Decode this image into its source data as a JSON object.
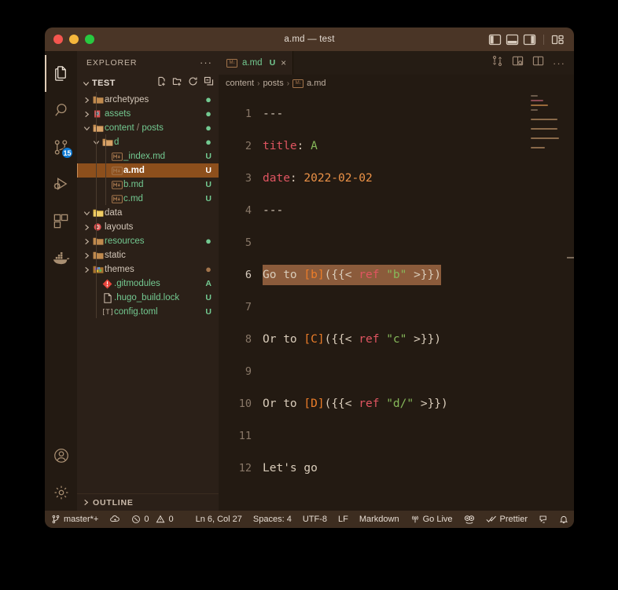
{
  "window": {
    "title": "a.md — test",
    "traffic_lights": [
      "close-red",
      "minimize-yellow",
      "maximize-green"
    ],
    "layout_controls": [
      "toggle-primary-sidebar",
      "toggle-panel",
      "toggle-secondary-sidebar",
      "customize-layout"
    ]
  },
  "activity_bar": {
    "items": [
      {
        "name": "explorer",
        "icon": "files-icon",
        "active": true,
        "badge": ""
      },
      {
        "name": "search",
        "icon": "search-icon",
        "active": false,
        "badge": ""
      },
      {
        "name": "source-control",
        "icon": "source-control-icon",
        "active": false,
        "badge": "15"
      },
      {
        "name": "run-and-debug",
        "icon": "run-debug-icon",
        "active": false,
        "badge": ""
      },
      {
        "name": "extensions",
        "icon": "extensions-icon",
        "active": false,
        "badge": ""
      },
      {
        "name": "docker",
        "icon": "docker-whale-icon",
        "active": false,
        "badge": ""
      }
    ],
    "bottom_items": [
      {
        "name": "accounts",
        "icon": "account-icon"
      },
      {
        "name": "manage-settings",
        "icon": "gear-icon"
      }
    ]
  },
  "sidebar": {
    "title": "EXPLORER",
    "more_actions": "···",
    "root": {
      "label": "TEST",
      "expanded": true,
      "actions": [
        "new-file-icon",
        "new-folder-icon",
        "refresh-icon",
        "collapse-all-icon"
      ]
    },
    "tree": [
      {
        "label": "archetypes",
        "indent": 1,
        "type": "folder",
        "icon": "folder-icon",
        "expanded": false,
        "status": "●",
        "status_kind": "g",
        "color": "default",
        "selected": false
      },
      {
        "label": "assets",
        "indent": 1,
        "type": "folder",
        "icon": "folder-assets-icon",
        "expanded": false,
        "status": "●",
        "status_kind": "g",
        "color": "green",
        "selected": false
      },
      {
        "label": "content / posts",
        "indent": 1,
        "type": "folder",
        "icon": "folder-open-icon",
        "expanded": true,
        "status": "●",
        "status_kind": "g",
        "color": "green",
        "selected": false
      },
      {
        "label": "d",
        "indent": 2,
        "type": "folder",
        "icon": "folder-open-icon",
        "expanded": true,
        "status": "●",
        "status_kind": "g",
        "color": "green",
        "selected": false
      },
      {
        "label": "_index.md",
        "indent": 3,
        "type": "file",
        "icon": "markdown-icon",
        "status": "U",
        "status_kind": "g",
        "color": "green",
        "selected": false
      },
      {
        "label": "a.md",
        "indent": 3,
        "type": "file",
        "icon": "markdown-icon",
        "status": "U",
        "status_kind": "sel",
        "color": "sel",
        "selected": true
      },
      {
        "label": "b.md",
        "indent": 3,
        "type": "file",
        "icon": "markdown-icon",
        "status": "U",
        "status_kind": "g",
        "color": "green",
        "selected": false
      },
      {
        "label": "c.md",
        "indent": 3,
        "type": "file",
        "icon": "markdown-icon",
        "status": "U",
        "status_kind": "g",
        "color": "green",
        "selected": false
      },
      {
        "label": "data",
        "indent": 1,
        "type": "folder",
        "icon": "folder-data-icon",
        "expanded": true,
        "status": "",
        "status_kind": "g",
        "color": "default",
        "selected": false
      },
      {
        "label": "layouts",
        "indent": 1,
        "type": "folder",
        "icon": "folder-layouts-icon",
        "expanded": false,
        "status": "",
        "status_kind": "g",
        "color": "default",
        "selected": false
      },
      {
        "label": "resources",
        "indent": 1,
        "type": "folder",
        "icon": "folder-icon",
        "expanded": false,
        "status": "●",
        "status_kind": "g",
        "color": "green",
        "selected": false
      },
      {
        "label": "static",
        "indent": 1,
        "type": "folder",
        "icon": "folder-icon",
        "expanded": false,
        "status": "",
        "status_kind": "g",
        "color": "default",
        "selected": false
      },
      {
        "label": "themes",
        "indent": 1,
        "type": "folder",
        "icon": "folder-themes-icon",
        "expanded": false,
        "status": "●",
        "status_kind": "brown",
        "color": "default",
        "selected": false
      },
      {
        "label": ".gitmodules",
        "indent": 2,
        "type": "file",
        "icon": "git-icon",
        "status": "A",
        "status_kind": "g",
        "color": "green",
        "selected": false
      },
      {
        "label": ".hugo_build.lock",
        "indent": 2,
        "type": "file",
        "icon": "file-icon",
        "status": "U",
        "status_kind": "g",
        "color": "green",
        "selected": false
      },
      {
        "label": "config.toml",
        "indent": 2,
        "type": "file",
        "icon": "toml-icon",
        "status": "U",
        "status_kind": "g",
        "color": "green",
        "selected": false
      }
    ],
    "outline": {
      "label": "OUTLINE",
      "expanded": false
    }
  },
  "editor": {
    "tab": {
      "icon": "markdown-icon",
      "label": "a.md",
      "git_badge": "U",
      "close": "×"
    },
    "actions": [
      "run-markdown-icon",
      "open-preview-to-side-icon",
      "split-editor-icon",
      "more-actions-icon"
    ],
    "breadcrumbs": [
      "content",
      "posts",
      "a.md"
    ],
    "breadcrumb_separator": "›",
    "lines": [
      {
        "n": "1",
        "current": false,
        "highlight": false,
        "tokens": [
          {
            "t": "---",
            "c": "t-hr"
          }
        ]
      },
      {
        "n": "2",
        "current": false,
        "highlight": false,
        "tokens": [
          {
            "t": "title",
            "c": "t-key"
          },
          {
            "t": ": ",
            "c": "t-colon"
          },
          {
            "t": "A",
            "c": "t-val-green"
          }
        ]
      },
      {
        "n": "3",
        "current": false,
        "highlight": false,
        "tokens": [
          {
            "t": "date",
            "c": "t-key"
          },
          {
            "t": ": ",
            "c": "t-colon"
          },
          {
            "t": "2022-02-02",
            "c": "t-num"
          }
        ]
      },
      {
        "n": "4",
        "current": false,
        "highlight": false,
        "tokens": [
          {
            "t": "---",
            "c": "t-hr"
          }
        ]
      },
      {
        "n": "5",
        "current": false,
        "highlight": false,
        "tokens": []
      },
      {
        "n": "6",
        "current": true,
        "highlight": true,
        "tokens": [
          {
            "t": "Go to ",
            "c": "t-plain"
          },
          {
            "t": "[",
            "c": "t-bracket"
          },
          {
            "t": "b",
            "c": "t-bracket"
          },
          {
            "t": "]",
            "c": "t-bracket"
          },
          {
            "t": "({{< ",
            "c": "t-brace"
          },
          {
            "t": "ref",
            "c": "t-ref"
          },
          {
            "t": " ",
            "c": "t-brace"
          },
          {
            "t": "\"b\"",
            "c": "t-str"
          },
          {
            "t": " >}})",
            "c": "t-brace"
          }
        ]
      },
      {
        "n": "7",
        "current": false,
        "highlight": false,
        "tokens": []
      },
      {
        "n": "8",
        "current": false,
        "highlight": false,
        "tokens": [
          {
            "t": "Or to ",
            "c": "t-plain"
          },
          {
            "t": "[",
            "c": "t-bracket"
          },
          {
            "t": "C",
            "c": "t-bracket"
          },
          {
            "t": "]",
            "c": "t-bracket"
          },
          {
            "t": "({{< ",
            "c": "t-brace"
          },
          {
            "t": "ref",
            "c": "t-ref"
          },
          {
            "t": " ",
            "c": "t-brace"
          },
          {
            "t": "\"c\"",
            "c": "t-str"
          },
          {
            "t": " >}})",
            "c": "t-brace"
          }
        ]
      },
      {
        "n": "9",
        "current": false,
        "highlight": false,
        "tokens": []
      },
      {
        "n": "10",
        "current": false,
        "highlight": false,
        "tokens": [
          {
            "t": "Or to ",
            "c": "t-plain"
          },
          {
            "t": "[",
            "c": "t-bracket"
          },
          {
            "t": "D",
            "c": "t-bracket"
          },
          {
            "t": "]",
            "c": "t-bracket"
          },
          {
            "t": "({{< ",
            "c": "t-brace"
          },
          {
            "t": "ref",
            "c": "t-ref"
          },
          {
            "t": " ",
            "c": "t-brace"
          },
          {
            "t": "\"d/\"",
            "c": "t-str"
          },
          {
            "t": " >}})",
            "c": "t-brace"
          }
        ]
      },
      {
        "n": "11",
        "current": false,
        "highlight": false,
        "tokens": []
      },
      {
        "n": "12",
        "current": false,
        "highlight": false,
        "tokens": [
          {
            "t": "Let's go",
            "c": "t-plain"
          }
        ]
      }
    ]
  },
  "status_bar": {
    "branch": "master*+",
    "branch_icon": "source-control-branch-icon",
    "sync_icon": "sync-cloud-icon",
    "errors": "0",
    "errors_icon": "error-circle-icon",
    "warnings": "0",
    "warnings_icon": "warning-triangle-icon",
    "cursor_position": "Ln 6, Col 27",
    "indentation": "Spaces: 4",
    "encoding": "UTF-8",
    "eol": "LF",
    "language": "Markdown",
    "go_live": "Go Live",
    "go_live_icon": "broadcast-icon",
    "face_icon": "smiley-icon",
    "prettier": "Prettier",
    "prettier_icon": "double-check-icon",
    "remote_icon": "remote-feedback-icon",
    "notifications_icon": "bell-icon"
  },
  "colors": {
    "titlebar": "#4a3526",
    "sidebar_bg": "#2b2018",
    "editor_bg": "#231a12",
    "statusbar_bg": "#3d2d20",
    "accent_selected_row": "#8d4f1c",
    "selection_highlight": "#8b5b3b",
    "git_untracked": "#73c991",
    "badge_blue": "#0e7ad4"
  }
}
